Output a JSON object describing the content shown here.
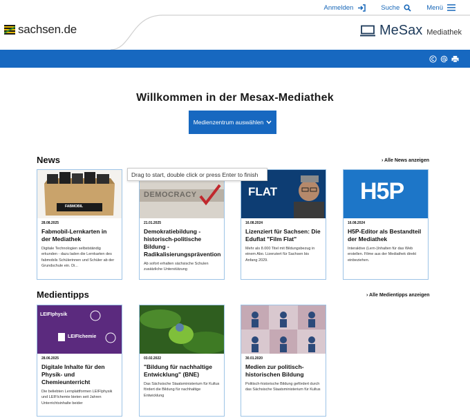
{
  "topnav": {
    "login_label": "Anmelden",
    "search_label": "Suche",
    "menu_label": "Menü"
  },
  "brand": {
    "site_name": "sachsen.de"
  },
  "mediathek": {
    "name": "MeSax",
    "subtitle": "Mediathek"
  },
  "bluebar_icons": [
    "copyright-icon",
    "at-icon",
    "print-icon"
  ],
  "hero": {
    "title": "Willkommen in der Mesax-Mediathek",
    "button_label": "Medienzentrum auswählen"
  },
  "tooltip": "Drag to start, double click or press Enter to finish",
  "news": {
    "title": "News",
    "all_link": "Alle News anzeigen",
    "cards": [
      {
        "date": "28.08.2025",
        "title": "Fabmobil-Lernkarten in der Mediathek",
        "desc": "Digitale Technologien selbstständig erkunden - dazu laden die Lernkarten des fabmobils Schülerinnen und Schüler ab der Grundschule ein. Di..."
      },
      {
        "date": "21.01.2025",
        "title": "Demokratiebildung - historisch-politische Bildung - Radikalisierungsprävention",
        "desc": "Ab sofort erhalten sächsische Schulen zusätzliche Unterstützung"
      },
      {
        "date": "16.08.2024",
        "title": "Lizenziert für Sachsen: Die Eduflat \"Film Flat\"",
        "desc": "Mehr als 8.000 Titel mit Bildungsbezug in einem Abo. Lizenziert für Sachsen bis Anfang 2029."
      },
      {
        "date": "16.08.2024",
        "title": "H5P-Editor als Bestandteil der Mediathek",
        "desc": "Interaktive (Lern-)Inhalten für das Web erstellen. Filme aus der Mediathek direkt einbeziehen."
      }
    ],
    "image_text": {
      "fabmobil": "FABMOBIL",
      "democracy": "DEMOCRACY",
      "filmflat": "FLAT",
      "h5p": "H5P"
    }
  },
  "medientipps": {
    "title": "Medientipps",
    "all_link": "Alle Medientipps anzeigen",
    "cards": [
      {
        "date": "28.06.2025",
        "title": "Digitale Inhalte für den Physik- und Chemieunterricht",
        "desc": "Die beliebten Lernplattformen LEIFIphysik und LEIFIchemie bieten seit Jahren Unterrichtsinhalte beider"
      },
      {
        "date": "03.02.2022",
        "title": "\"Bildung für nachhaltige Entwicklung\" (BNE)",
        "desc": "Das Sächsische Staatsministerium für Kultus fördert die Bildung für nachhaltige Entwicklung"
      },
      {
        "date": "30.01.2020",
        "title": "Medien zur politisch-historischen Bildung",
        "desc": "Politisch-historische Bildung gefördert durch das Sächsische Staatsministerium für Kultus"
      }
    ],
    "image_text": {
      "leifiphysik": "LEIFIphysik",
      "leifichemie": "LEIFIchemie"
    }
  },
  "colors": {
    "primary_blue": "#1768c0",
    "card_border": "#9cc3e6"
  }
}
